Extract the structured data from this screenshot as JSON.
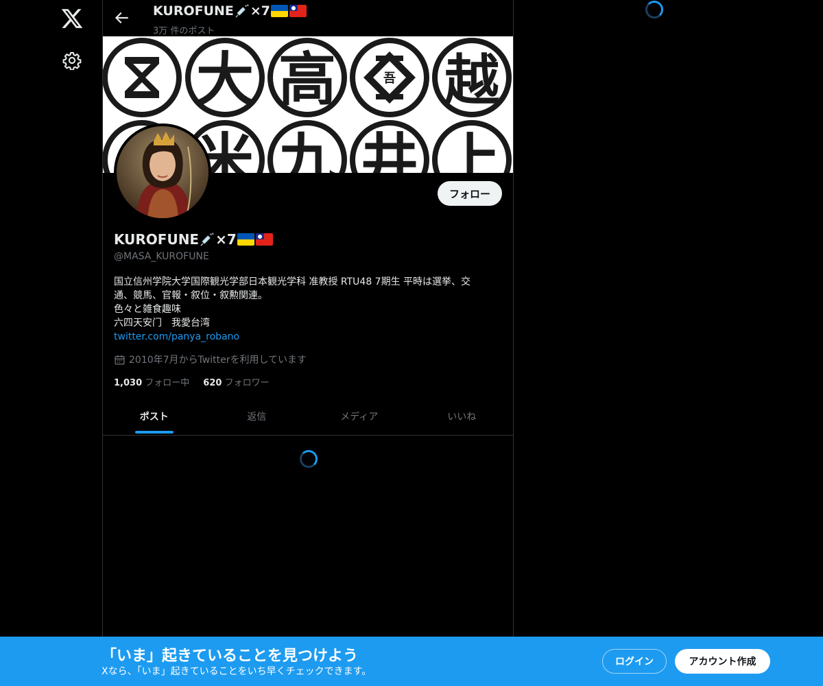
{
  "header": {
    "name": "KUROFUNE",
    "name_suffix": "×7",
    "post_count": "3万 件のポスト"
  },
  "profile": {
    "display_name": "KUROFUNE",
    "display_name_suffix": "×7",
    "handle": "@MASA_KUROFUNE",
    "follow_label": "フォロー",
    "bio": {
      "line1": "国立信州学院大学国際観光学部日本観光学科 准教授 RTU48 7期生 平時は選挙、交",
      "line2": "通、競馬、官報・叙位・叙勲関連。",
      "line3": "色々と雑食趣味",
      "line4": "六四天安门　我愛台湾",
      "link": "twitter.com/panya_robano"
    },
    "joined": "2010年7月からTwitterを利用しています",
    "following_count": "1,030",
    "following_label": "フォロー中",
    "followers_count": "620",
    "followers_label": "フォロワー"
  },
  "banner": {
    "kanji_row1": [
      "",
      "大",
      "高",
      "",
      ""
    ],
    "kanji_row2": [
      "",
      "",
      "九",
      "井",
      "上"
    ]
  },
  "tabs": [
    {
      "label": "ポスト",
      "active": true
    },
    {
      "label": "返信",
      "active": false
    },
    {
      "label": "メディア",
      "active": false
    },
    {
      "label": "いいね",
      "active": false
    }
  ],
  "bottom_bar": {
    "title": "「いま」起きていることを見つけよう",
    "subtitle": "Xなら、「いま」起きていることをいち早くチェックできます。",
    "login_label": "ログイン",
    "signup_label": "アカウント作成"
  },
  "icons": {
    "logo": "x-logo-icon",
    "settings": "gear-icon",
    "back": "arrow-left-icon",
    "calendar": "calendar-icon"
  },
  "colors": {
    "accent": "#1d9bf0",
    "background": "#000000",
    "muted_text": "#71767b"
  }
}
